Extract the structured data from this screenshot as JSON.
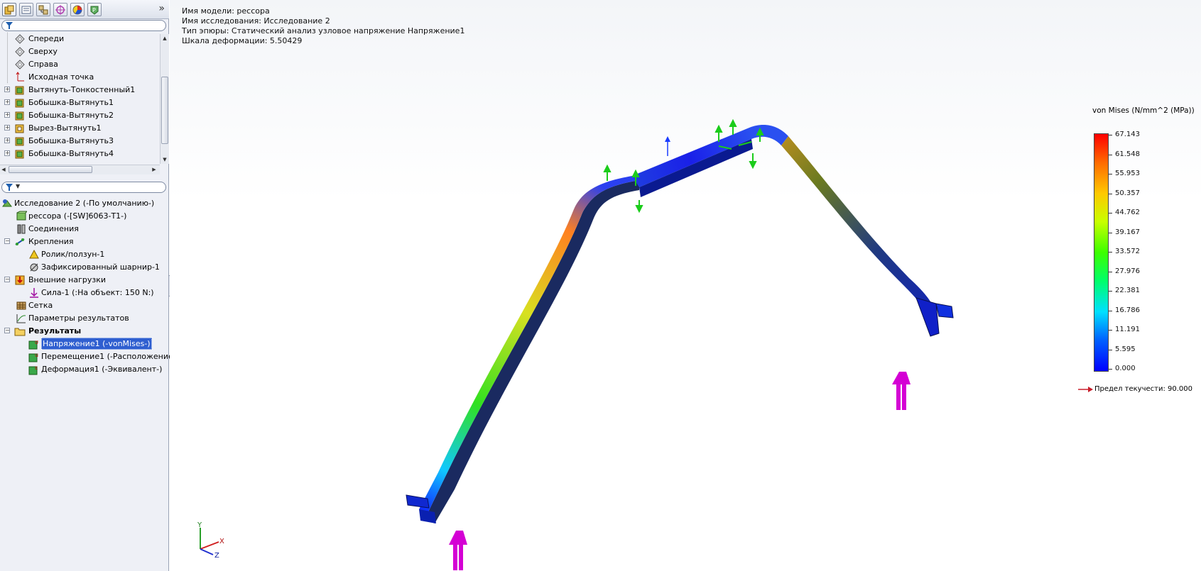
{
  "tabs": [
    {
      "name": "feature-manager-tab",
      "color": "#c98a1e"
    },
    {
      "name": "property-manager-tab",
      "color": "#7a8ba8"
    },
    {
      "name": "configuration-manager-tab",
      "color": "#b08a40"
    },
    {
      "name": "dimxpert-tab",
      "color": "#b040b0"
    },
    {
      "name": "display-manager-tab",
      "color": "#d04030"
    },
    {
      "name": "simulation-tab",
      "color": "#3a8a3a"
    }
  ],
  "feature_tree": [
    {
      "label": "Спереди",
      "icon": "plane-icon",
      "expand": false
    },
    {
      "label": "Сверху",
      "icon": "plane-icon",
      "expand": false
    },
    {
      "label": "Справа",
      "icon": "plane-icon",
      "expand": false
    },
    {
      "label": "Исходная точка",
      "icon": "origin-icon",
      "expand": false
    },
    {
      "label": "Вытянуть-Тонкостенный1",
      "icon": "extrude-icon",
      "expand": true
    },
    {
      "label": "Бобышка-Вытянуть1",
      "icon": "extrude-icon",
      "expand": true
    },
    {
      "label": "Бобышка-Вытянуть2",
      "icon": "extrude-icon",
      "expand": true
    },
    {
      "label": "Вырез-Вытянуть1",
      "icon": "cut-extrude-icon",
      "expand": true
    },
    {
      "label": "Бобышка-Вытянуть3",
      "icon": "extrude-icon",
      "expand": true
    },
    {
      "label": "Бобышка-Вытянуть4",
      "icon": "extrude-icon",
      "expand": true
    }
  ],
  "sim_tree": {
    "study": "Исследование 2 (-По умолчанию-)",
    "part": "рессора (-[SW]6063-T1-)",
    "connections": "Соединения",
    "fixtures": "Крепления",
    "fixture_items": [
      "Ролик/ползун-1",
      "Зафиксированный шарнир-1"
    ],
    "loads": "Внешние нагрузки",
    "load_items": [
      "Сила-1 (:На объект: 150 N:)"
    ],
    "mesh": "Сетка",
    "result_options": "Параметры результатов",
    "results": "Результаты",
    "result_items": [
      "Напряжение1 (-vonMises-)",
      "Перемещение1 (-Расположение",
      "Деформация1 (-Эквивалент-)"
    ]
  },
  "info": {
    "model": "Имя модели: рессора",
    "study": "Имя  исследования: Исследование 2",
    "plot_type": "Тип эпюры: Статический анализ узловое напряжение Напряжение1",
    "deformation_scale": "Шкала деформации: 5.50429"
  },
  "legend": {
    "title": "von Mises (N/mm^2 (MPa))",
    "ticks": [
      "67.143",
      "61.548",
      "55.953",
      "50.357",
      "44.762",
      "39.167",
      "33.572",
      "27.976",
      "22.381",
      "16.786",
      "11.191",
      "5.595",
      "0.000"
    ],
    "yield": "Предел текучести: 90.000",
    "yield_color": "#c81e2a"
  },
  "triad": {
    "x": "X",
    "y": "Y",
    "z": "Z"
  },
  "colors": {
    "force_arrow": "#d400d4",
    "fixture_arrow": "#1bcc1b",
    "load_arrow": "#1a3cff"
  }
}
